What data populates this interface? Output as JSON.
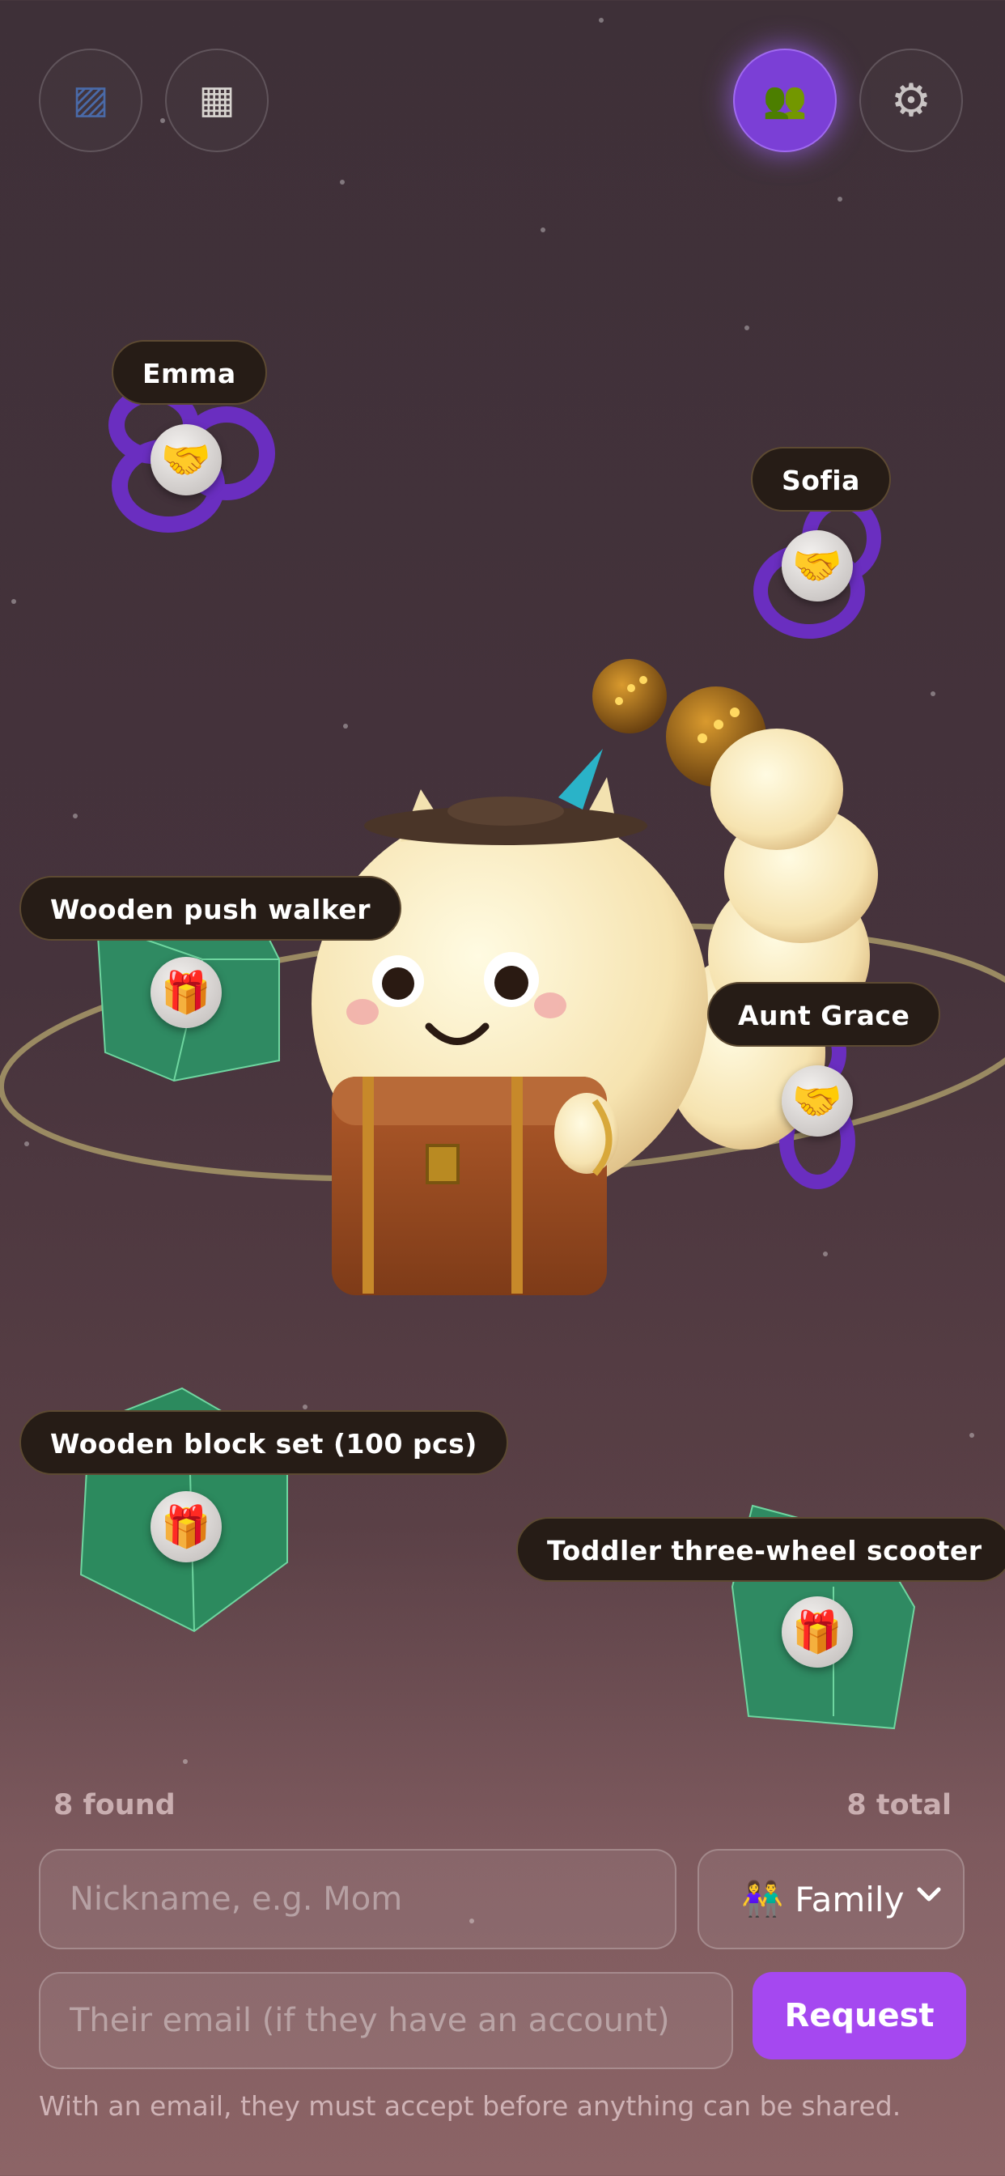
{
  "toolbar": {
    "left": [
      {
        "icon": "diagonal-stripes-icon",
        "glyph": "▨"
      },
      {
        "icon": "grid-icon",
        "glyph": "▦"
      }
    ],
    "right": [
      {
        "icon": "people-icon",
        "glyph": "👥",
        "active": true
      },
      {
        "icon": "gear-icon",
        "glyph": "⚙"
      }
    ]
  },
  "scene": {
    "people": [
      {
        "name": "Emma",
        "icon": "handshake-icon",
        "glyph": "🤝"
      },
      {
        "name": "Sofia",
        "icon": "handshake-icon",
        "glyph": "🤝"
      },
      {
        "name": "Aunt Grace",
        "icon": "handshake-icon",
        "glyph": "🤝"
      }
    ],
    "gifts": [
      {
        "name": "Wooden push walker",
        "icon": "gift-icon",
        "glyph": "🎁"
      },
      {
        "name": "Wooden block set (100 pcs)",
        "icon": "gift-icon",
        "glyph": "🎁"
      },
      {
        "name": "Toddler three-wheel scooter",
        "icon": "gift-icon",
        "glyph": "🎁"
      }
    ]
  },
  "summary": {
    "found": "8 found",
    "total": "8 total"
  },
  "form": {
    "nickname_placeholder": "Nickname, e.g. Mom",
    "nickname_value": "",
    "relationship_glyph": "👫",
    "relationship_value": "Family",
    "email_placeholder": "Their email (if they have an account)",
    "email_value": "",
    "request_label": "Request",
    "hint": "With an email, they must accept before anything can be shared."
  },
  "colors": {
    "accent": "#a548f0",
    "label_bg": "#261c16",
    "ring_purple": "#6a2ec0",
    "box_green": "#2f8a62"
  }
}
